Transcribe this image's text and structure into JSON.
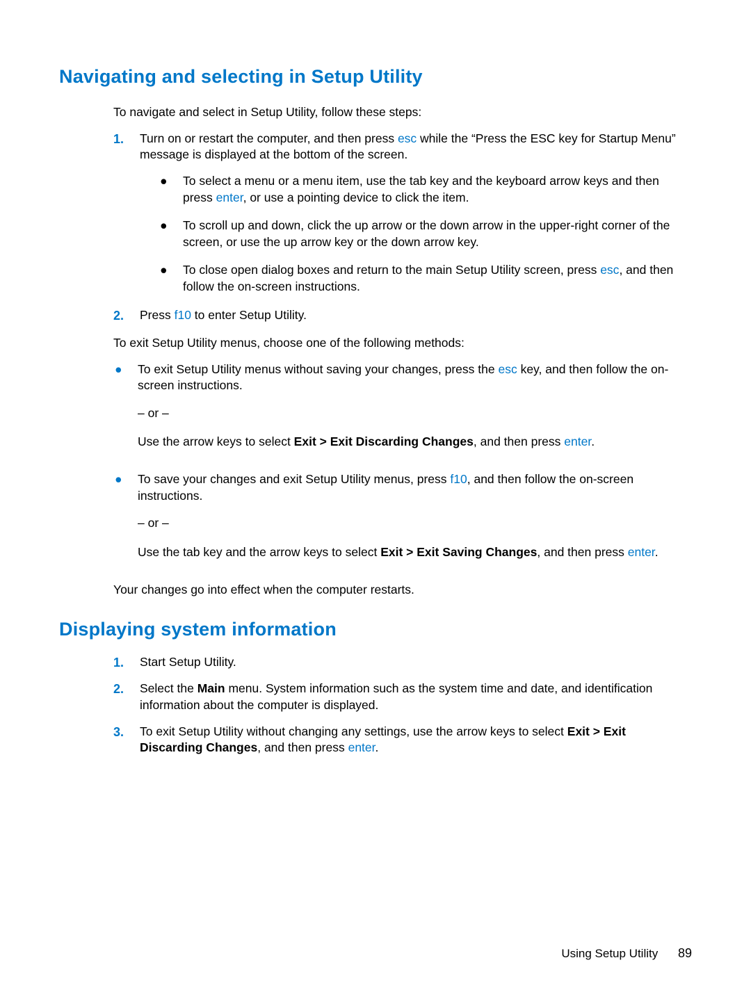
{
  "section1": {
    "heading": "Navigating and selecting in Setup Utility",
    "intro": "To navigate and select in Setup Utility, follow these steps:",
    "step1_num": "1.",
    "step1_a": "Turn on or restart the computer, and then press ",
    "step1_key": "esc",
    "step1_b": " while the “Press the ESC key for Startup Menu” message is displayed at the bottom of the screen.",
    "s1_bullet1_a": "To select a menu or a menu item, use the tab key and the keyboard arrow keys and then press ",
    "s1_bullet1_key": "enter",
    "s1_bullet1_b": ", or use a pointing device to click the item.",
    "s1_bullet2": "To scroll up and down, click the up arrow or the down arrow in the upper-right corner of the screen, or use the up arrow key or the down arrow key.",
    "s1_bullet3_a": "To close open dialog boxes and return to the main Setup Utility screen, press ",
    "s1_bullet3_key": "esc",
    "s1_bullet3_b": ", and then follow the on-screen instructions.",
    "step2_num": "2.",
    "step2_a": "Press ",
    "step2_key": "f10",
    "step2_b": " to enter Setup Utility.",
    "exit_intro": "To exit Setup Utility menus, choose one of the following methods:",
    "exit1_a": "To exit Setup Utility menus without saving your changes, press the ",
    "exit1_key": "esc",
    "exit1_b": " key, and then follow the on-screen instructions.",
    "or": "– or –",
    "exit1_alt_a": "Use the arrow keys to select ",
    "exit1_alt_bold": "Exit > Exit Discarding Changes",
    "exit1_alt_b": ", and then press ",
    "exit1_alt_key": "enter",
    "exit1_alt_c": ".",
    "exit2_a": "To save your changes and exit Setup Utility menus, press ",
    "exit2_key": "f10",
    "exit2_b": ", and then follow the on-screen instructions.",
    "exit2_alt_a": "Use the tab key and the arrow keys to select ",
    "exit2_alt_bold": "Exit > Exit Saving Changes",
    "exit2_alt_b": ", and then press ",
    "exit2_alt_key": "enter",
    "exit2_alt_c": ".",
    "footer_line": "Your changes go into effect when the computer restarts."
  },
  "section2": {
    "heading": "Displaying system information",
    "step1_num": "1.",
    "step1": "Start Setup Utility.",
    "step2_num": "2.",
    "step2_a": "Select the ",
    "step2_bold": "Main",
    "step2_b": " menu. System information such as the system time and date, and identification information about the computer is displayed.",
    "step3_num": "3.",
    "step3_a": "To exit Setup Utility without changing any settings, use the arrow keys to select ",
    "step3_bold": "Exit > Exit Discarding Changes",
    "step3_b": ", and then press ",
    "step3_key": "enter",
    "step3_c": "."
  },
  "footer": {
    "text": "Using Setup Utility",
    "page": "89"
  }
}
